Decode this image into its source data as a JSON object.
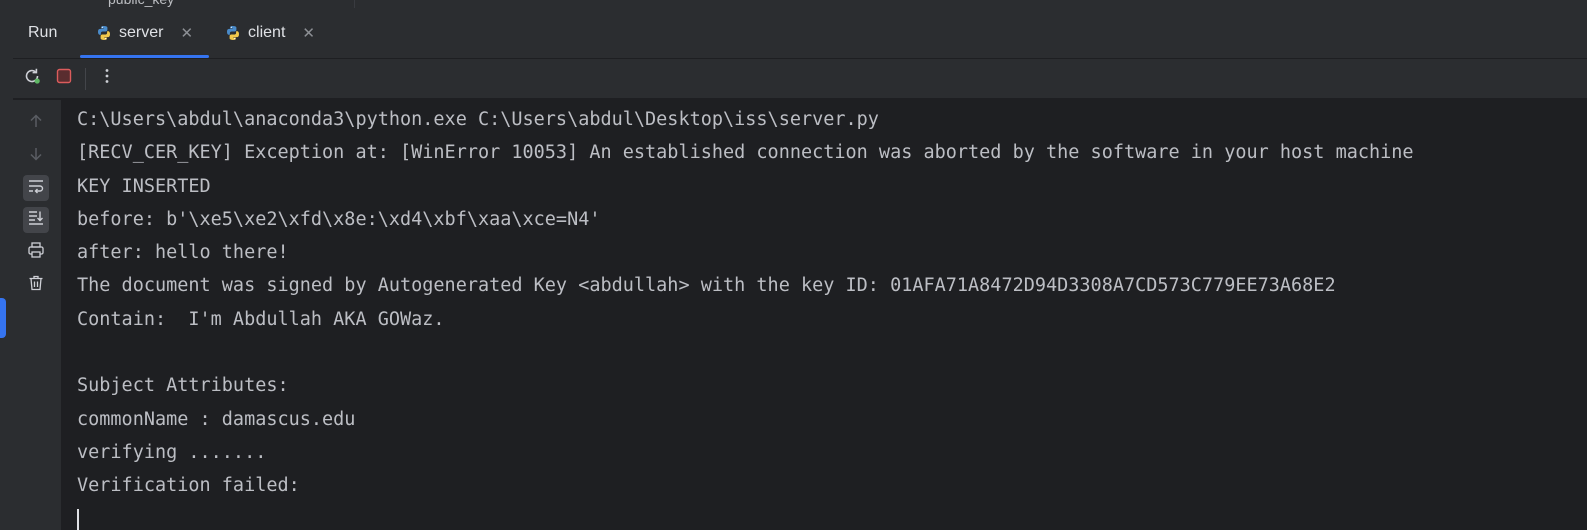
{
  "window": {
    "tree_fragment": "public_key",
    "panel_title": "Run"
  },
  "tabs": [
    {
      "label": "server",
      "icon": "python-icon",
      "active": true
    },
    {
      "label": "client",
      "icon": "python-icon",
      "active": false
    }
  ],
  "toolbar": {
    "buttons": [
      "rerun-icon",
      "stop-icon",
      "more-options-icon"
    ]
  },
  "gutter": {
    "buttons": [
      "up-arrow-icon",
      "down-arrow-icon",
      "soft-wrap-icon",
      "scroll-to-end-icon",
      "print-icon",
      "trash-icon"
    ]
  },
  "console": {
    "lines": [
      "C:\\Users\\abdul\\anaconda3\\python.exe C:\\Users\\abdul\\Desktop\\iss\\server.py",
      "[RECV_CER_KEY] Exception at: [WinError 10053] An established connection was aborted by the software in your host machine",
      "KEY INSERTED",
      "before: b'\\xe5\\xe2\\xfd\\x8e:\\xd4\\xbf\\xaa\\xce=N4'",
      "after: hello there!",
      "The document was signed by Autogenerated Key <abdullah> with the key ID: 01AFA71A8472D94D3308A7CD573C779EE73A68E2",
      "Contain:  I'm Abdullah AKA GOWaz.",
      "",
      "Subject Attributes:",
      "commonName : damascus.edu",
      "verifying .......",
      "Verification failed:"
    ]
  },
  "colors": {
    "background": "#1e1f22",
    "panel": "#2b2d30",
    "accent": "#3574f0",
    "text": "#bcbec4",
    "stop": "#db5c5c",
    "rerun": "#5fb865"
  }
}
